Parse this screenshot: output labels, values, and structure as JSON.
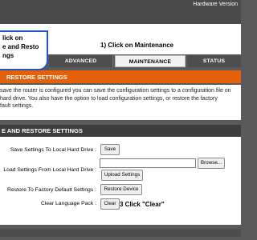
{
  "header": {
    "hardware_version_text": "Hardware Version"
  },
  "instructions": {
    "step1": "1) Click on Maintenance",
    "step2_lines": [
      "lick on",
      "e and Resto",
      "ngs"
    ],
    "step3": "3 Click \"Clear\""
  },
  "tabs": [
    {
      "label": "ADVANCED",
      "active": false
    },
    {
      "label": "MAINTENANCE",
      "active": true
    },
    {
      "label": "STATUS",
      "active": false
    }
  ],
  "section_top": {
    "title": "RESTORE SETTINGS",
    "description_lines": [
      "save the router is configured you can save the configuration settings to a configuration file on",
      "hard drive. You also have the option to load configuration settings, or restore the factory",
      "fault settings."
    ]
  },
  "section_main": {
    "title": "E AND RESTORE SETTINGS",
    "rows": [
      {
        "label": "Save Settings To Local Hard Drive :",
        "button": "Save"
      },
      {
        "label": "Load Settings From Local Hard Drive :",
        "browse_button": "Browse...",
        "button": "Upload Settings"
      },
      {
        "label": "Restore To Factory Default Settings :",
        "button": "Restore Device"
      },
      {
        "label": "Clear Language Pack :",
        "button": "Clear"
      }
    ]
  },
  "colors": {
    "accent_orange": "#e4610b",
    "callout_border": "#2455c4",
    "dark_header": "#3d3d3d",
    "frame_grey": "#5a5a5a"
  }
}
